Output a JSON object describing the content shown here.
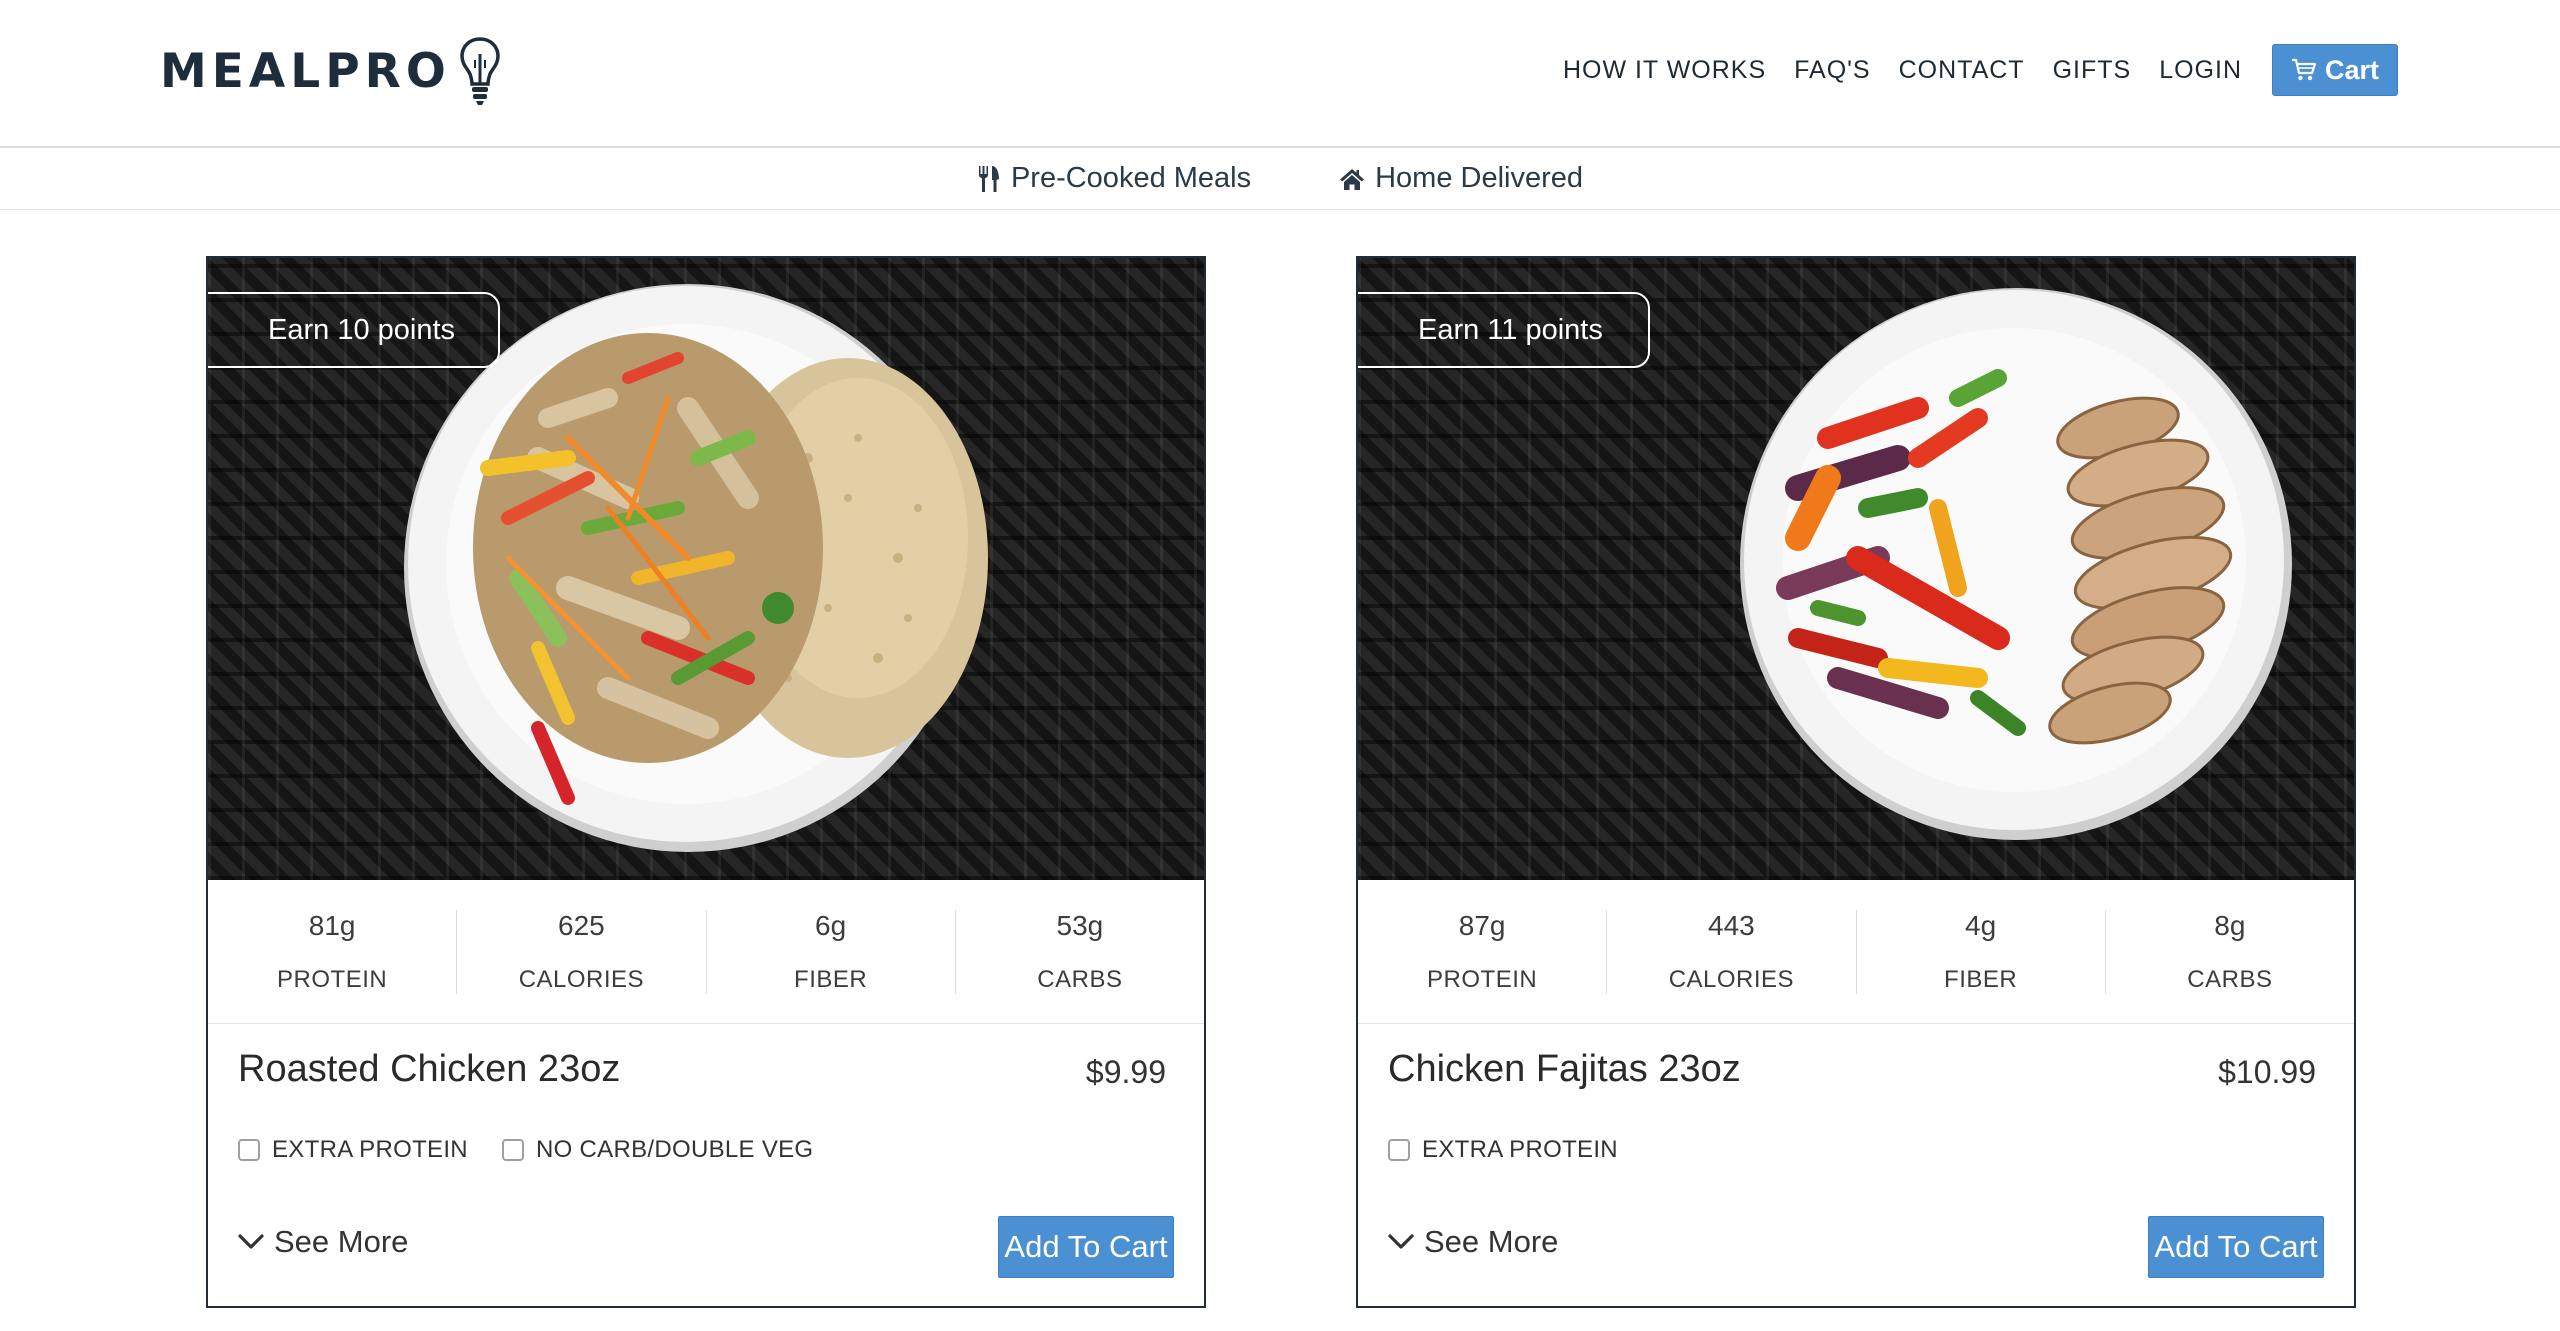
{
  "brand": {
    "name": "MEALPRO"
  },
  "nav": {
    "links": [
      "HOW IT WORKS",
      "FAQ'S",
      "CONTACT",
      "GIFTS",
      "LOGIN"
    ],
    "cart_label": "Cart"
  },
  "subnav": {
    "items": [
      {
        "label": "Pre-Cooked Meals",
        "icon": "fork-knife-icon"
      },
      {
        "label": "Home Delivered",
        "icon": "home-icon"
      }
    ]
  },
  "colors": {
    "brand_dark": "#1e2d3b",
    "accent_blue": "#4a90d2"
  },
  "meals": [
    {
      "points_badge": "Earn 10 points",
      "nutrition": [
        {
          "value": "81g",
          "label": "PROTEIN"
        },
        {
          "value": "625",
          "label": "CALORIES"
        },
        {
          "value": "6g",
          "label": "FIBER"
        },
        {
          "value": "53g",
          "label": "CARBS"
        }
      ],
      "title": "Roasted Chicken 23oz",
      "price": "$9.99",
      "options": [
        "EXTRA PROTEIN",
        "NO CARB/DOUBLE VEG"
      ],
      "see_more": "See More",
      "add_to_cart": "Add To Cart"
    },
    {
      "points_badge": "Earn 11 points",
      "nutrition": [
        {
          "value": "87g",
          "label": "PROTEIN"
        },
        {
          "value": "443",
          "label": "CALORIES"
        },
        {
          "value": "4g",
          "label": "FIBER"
        },
        {
          "value": "8g",
          "label": "CARBS"
        }
      ],
      "title": "Chicken Fajitas 23oz",
      "price": "$10.99",
      "options": [
        "EXTRA PROTEIN"
      ],
      "see_more": "See More",
      "add_to_cart": "Add To Cart"
    }
  ]
}
